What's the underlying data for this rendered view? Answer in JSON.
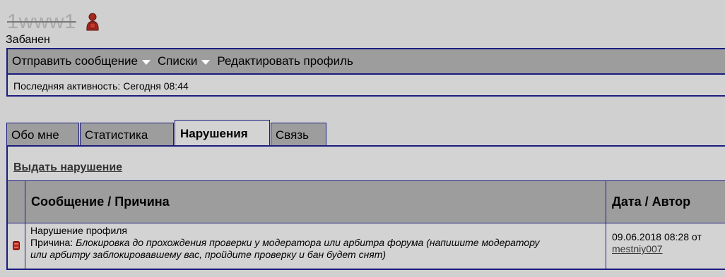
{
  "profile": {
    "username": "1www1",
    "user_title": "Забанен",
    "menu": [
      {
        "label": "Отправить сообщение",
        "has_dropdown": true
      },
      {
        "label": "Списки",
        "has_dropdown": true
      },
      {
        "label": "Редактировать профиль",
        "has_dropdown": false
      }
    ],
    "last_activity": "Последняя активность: Сегодня 08:44"
  },
  "tabs": [
    {
      "label": "Обо мне",
      "active": false
    },
    {
      "label": "Статистика",
      "active": false
    },
    {
      "label": "Нарушения",
      "active": true
    },
    {
      "label": "Связь",
      "active": false
    }
  ],
  "infractions": {
    "give_link": "Выдать нарушение",
    "headers": {
      "message_reason": "Сообщение / Причина",
      "date_author": "Дата / Автор"
    },
    "rows": [
      {
        "icon": "red-infraction-icon",
        "title": "Нарушение профиля",
        "reason_label": "Причина: ",
        "reason_line1": "Блокировка до прохождения проверки у модератора или арбитра форума (напишите модератору",
        "reason_line2": "или арбитру заблокировавшему вас, пройдите проверку и бан будет снят)",
        "date": "09.06.2018 08:28 от",
        "author": "mestniy007"
      }
    ]
  },
  "colors": {
    "background": "#d0d0d0",
    "header_gray": "#9d9d9d",
    "border_navy": "#1c1d7e",
    "icon_red": "#b3281e"
  }
}
